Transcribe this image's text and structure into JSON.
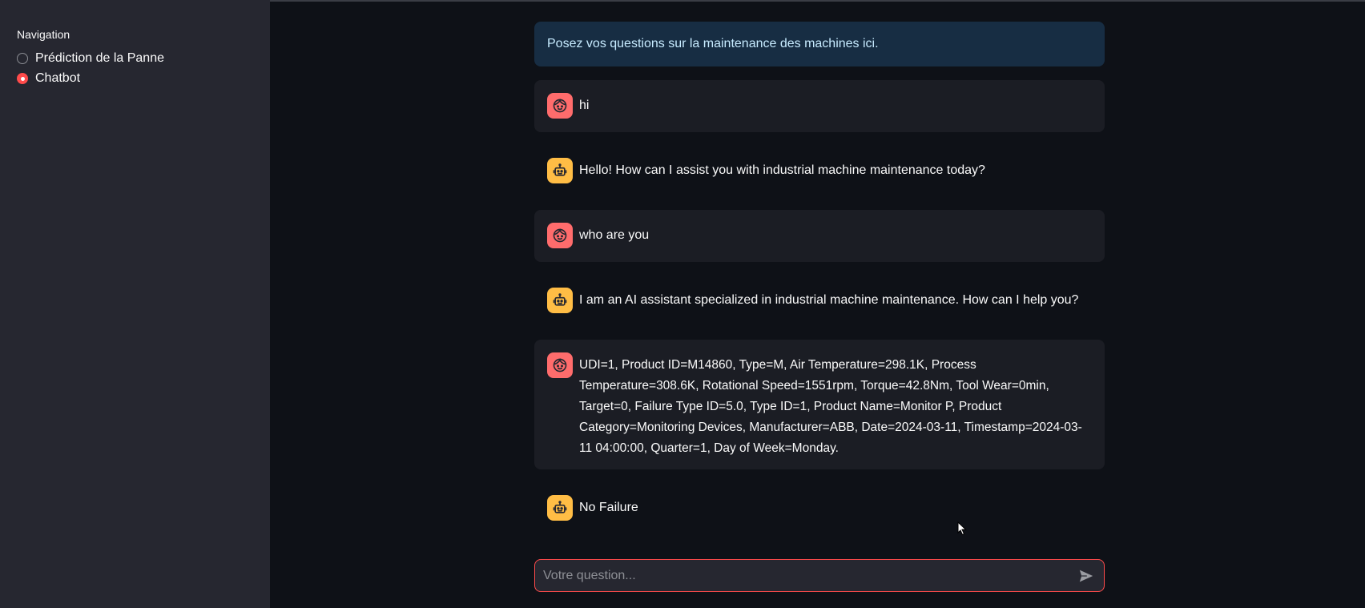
{
  "sidebar": {
    "title": "Navigation",
    "options": [
      {
        "label": "Prédiction de la Panne",
        "selected": false
      },
      {
        "label": "Chatbot",
        "selected": true
      }
    ]
  },
  "info": "Posez vos questions sur la maintenance des machines ici.",
  "messages": [
    {
      "role": "user",
      "text": "hi"
    },
    {
      "role": "assistant",
      "text": "Hello! How can I assist you with industrial machine maintenance today?"
    },
    {
      "role": "user",
      "text": "who are you"
    },
    {
      "role": "assistant",
      "text": "I am an AI assistant specialized in industrial machine maintenance. How can I help you?"
    },
    {
      "role": "user",
      "text": "UDI=1, Product ID=M14860, Type=M, Air Temperature=298.1K, Process Temperature=308.6K, Rotational Speed=1551rpm, Torque=42.8Nm, Tool Wear=0min, Target=0, Failure Type ID=5.0, Type ID=1, Product Name=Monitor P, Product Category=Monitoring Devices, Manufacturer=ABB, Date=2024-03-11, Timestamp=2024-03-11 04:00:00, Quarter=1, Day of Week=Monday."
    },
    {
      "role": "assistant",
      "text": "No Failure"
    }
  ],
  "chat_input": {
    "placeholder": "Votre question...",
    "value": ""
  },
  "icons": {
    "user_avatar": "user-face-icon",
    "assistant_avatar": "robot-icon",
    "send": "send-icon"
  },
  "colors": {
    "accent": "#ff4b4b",
    "user_avatar": "#ff6c6c",
    "assistant_avatar": "#ffbd45",
    "info_bg": "#172d43"
  }
}
